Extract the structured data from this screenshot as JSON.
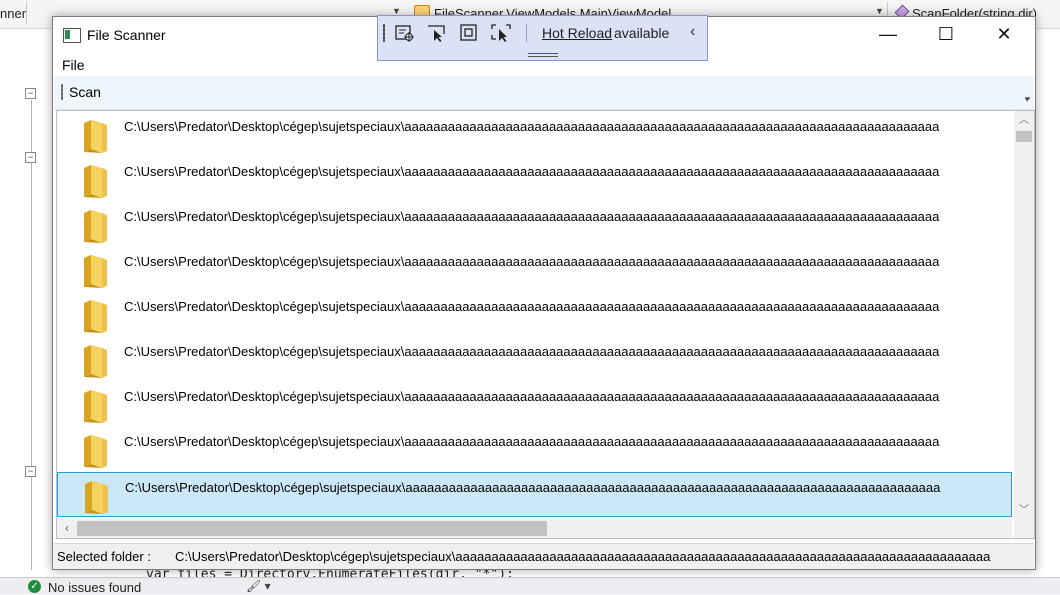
{
  "vs": {
    "left_tab_fragment": "nner",
    "crumb_viewmodel": "FileScanner.ViewModels.MainViewModel",
    "crumb_method": "ScanFolder(string dir)",
    "code_line": "var files = Directory.EnumerateFiles(dir, \"*\");",
    "status": "No issues found"
  },
  "window": {
    "title": "File Scanner",
    "menu": {
      "file": "File"
    },
    "toolbar": {
      "scan": "Scan"
    },
    "caption": {
      "minimize": "—",
      "maximize": "☐",
      "close": "✕"
    }
  },
  "hot_reload": {
    "link": "Hot Reload",
    "text": "available",
    "collapse": "‹"
  },
  "list": {
    "items": [
      "C:\\Users\\Predator\\Desktop\\cégep\\sujetspeciaux\\aaaaaaaaaaaaaaaaaaaaaaaaaaaaaaaaaaaaaaaaaaaaaaaaaaaaaaaaaaaaaaaaaaaaaaaaaa",
      "C:\\Users\\Predator\\Desktop\\cégep\\sujetspeciaux\\aaaaaaaaaaaaaaaaaaaaaaaaaaaaaaaaaaaaaaaaaaaaaaaaaaaaaaaaaaaaaaaaaaaaaaaaaa",
      "C:\\Users\\Predator\\Desktop\\cégep\\sujetspeciaux\\aaaaaaaaaaaaaaaaaaaaaaaaaaaaaaaaaaaaaaaaaaaaaaaaaaaaaaaaaaaaaaaaaaaaaaaaaa",
      "C:\\Users\\Predator\\Desktop\\cégep\\sujetspeciaux\\aaaaaaaaaaaaaaaaaaaaaaaaaaaaaaaaaaaaaaaaaaaaaaaaaaaaaaaaaaaaaaaaaaaaaaaaaa",
      "C:\\Users\\Predator\\Desktop\\cégep\\sujetspeciaux\\aaaaaaaaaaaaaaaaaaaaaaaaaaaaaaaaaaaaaaaaaaaaaaaaaaaaaaaaaaaaaaaaaaaaaaaaaa",
      "C:\\Users\\Predator\\Desktop\\cégep\\sujetspeciaux\\aaaaaaaaaaaaaaaaaaaaaaaaaaaaaaaaaaaaaaaaaaaaaaaaaaaaaaaaaaaaaaaaaaaaaaaaaa",
      "C:\\Users\\Predator\\Desktop\\cégep\\sujetspeciaux\\aaaaaaaaaaaaaaaaaaaaaaaaaaaaaaaaaaaaaaaaaaaaaaaaaaaaaaaaaaaaaaaaaaaaaaaaaa",
      "C:\\Users\\Predator\\Desktop\\cégep\\sujetspeciaux\\aaaaaaaaaaaaaaaaaaaaaaaaaaaaaaaaaaaaaaaaaaaaaaaaaaaaaaaaaaaaaaaaaaaaaaaaaa",
      "C:\\Users\\Predator\\Desktop\\cégep\\sujetspeciaux\\aaaaaaaaaaaaaaaaaaaaaaaaaaaaaaaaaaaaaaaaaaaaaaaaaaaaaaaaaaaaaaaaaaaaaaaaaa"
    ],
    "selected_index": 8
  },
  "status": {
    "label": "Selected folder :",
    "value": "C:\\Users\\Predator\\Desktop\\cégep\\sujetspeciaux\\aaaaaaaaaaaaaaaaaaaaaaaaaaaaaaaaaaaaaaaaaaaaaaaaaaaaaaaaaaaaaaaaaaaaaaaaaa"
  },
  "colors": {
    "selection_bg": "#cce8f6",
    "selection_border": "#26a0da",
    "folder_yellow": "#f3c94e",
    "hotreload_bg": "#dde1f6"
  }
}
